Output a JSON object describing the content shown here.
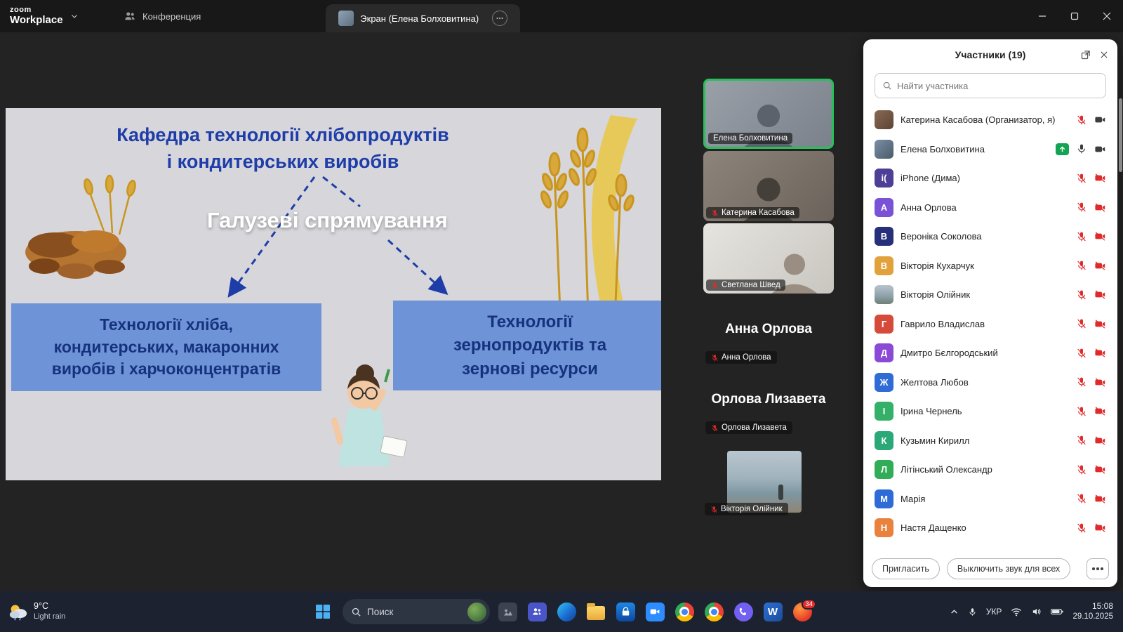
{
  "titlebar": {
    "logo_top": "zoom",
    "logo_bottom": "Workplace",
    "tab_conference": "Конференция",
    "tab_screen": "Экран (Елена Болховитина)"
  },
  "slide": {
    "title_line1": "Кафедра технології хлібопродуктів",
    "title_line2": "і кондитерських виробів",
    "subtitle": "Галузеві спрямування",
    "left_box": "Технології хліба,\nкондитерських, макаронних\nвиробів і харчоконцентратів",
    "right_box": "Технології\nзернопродуктів та\nзернові ресурси"
  },
  "videos": {
    "tile1_name": "Елена Болховитина",
    "tile2_name": "Катерина Касабова",
    "tile3_name": "Светлана Швед",
    "big1": "Анна Орлова",
    "pill1": "Анна Орлова",
    "big2": "Орлова Лизавета",
    "pill2": "Орлова Лизавета",
    "pill3": "Вікторія Олійник"
  },
  "participants": {
    "title": "Участники (19)",
    "search_placeholder": "Найти участника",
    "invite": "Пригласить",
    "mute_all": "Выключить звук для всех",
    "list": [
      {
        "name": "Катерина Касабова (Организатор, я)",
        "photoClass": "ph-kateryna",
        "mic": "mic-muted",
        "cam": "cam-on",
        "share": "no-share"
      },
      {
        "name": "Елена Болховитина",
        "photoClass": "ph-elena",
        "mic": "mic-on",
        "cam": "cam-on",
        "share": "sharing"
      },
      {
        "name": "iPhone (Дима)",
        "initial": "i(",
        "color": "#4d3e96",
        "mic": "mic-muted",
        "cam": "cam-off",
        "share": "no-share"
      },
      {
        "name": "Анна Орлова",
        "initial": "А",
        "color": "#7a52d6",
        "mic": "mic-muted",
        "cam": "cam-off",
        "share": "no-share"
      },
      {
        "name": "Вероніка Соколова",
        "initial": "В",
        "color": "#252f7a",
        "mic": "mic-muted",
        "cam": "cam-off",
        "share": "no-share"
      },
      {
        "name": "Вікторія Кухарчук",
        "initial": "В",
        "color": "#e2a23b",
        "mic": "mic-muted",
        "cam": "cam-off",
        "share": "no-share"
      },
      {
        "name": "Вікторія Олійник",
        "photoClass": "ph-beach",
        "mic": "mic-muted",
        "cam": "cam-off",
        "share": "no-share"
      },
      {
        "name": "Гаврило Владислав",
        "initial": "Г",
        "color": "#d64a3a",
        "mic": "mic-muted",
        "cam": "cam-off",
        "share": "no-share"
      },
      {
        "name": "Дмитро Бєлгородський",
        "initial": "Д",
        "color": "#8a4ad6",
        "mic": "mic-muted",
        "cam": "cam-off",
        "share": "no-share"
      },
      {
        "name": "Желтова Любов",
        "initial": "Ж",
        "color": "#2f6bd6",
        "mic": "mic-muted",
        "cam": "cam-off",
        "share": "no-share"
      },
      {
        "name": "Ірина Чернель",
        "initial": "І",
        "color": "#35b069",
        "mic": "mic-muted",
        "cam": "cam-off",
        "share": "no-share"
      },
      {
        "name": "Кузьмин Кирилл",
        "initial": "К",
        "color": "#2aa878",
        "mic": "mic-muted",
        "cam": "cam-off",
        "share": "no-share"
      },
      {
        "name": "Літінський Олександр",
        "initial": "Л",
        "color": "#31ad57",
        "mic": "mic-muted",
        "cam": "cam-off",
        "share": "no-share"
      },
      {
        "name": "Марія",
        "initial": "М",
        "color": "#2f6bd6",
        "mic": "mic-muted",
        "cam": "cam-off",
        "share": "no-share"
      },
      {
        "name": "Настя Дащенко",
        "initial": "Н",
        "color": "#e8823c",
        "mic": "mic-muted",
        "cam": "cam-off",
        "share": "no-share"
      }
    ]
  },
  "taskbar": {
    "weather_temp": "9°C",
    "weather_desc": "Light rain",
    "search_label": "Поиск",
    "word_letter": "W",
    "badge": "34",
    "lang": "УКР",
    "time": "15:08",
    "date": "29.10.2025"
  }
}
